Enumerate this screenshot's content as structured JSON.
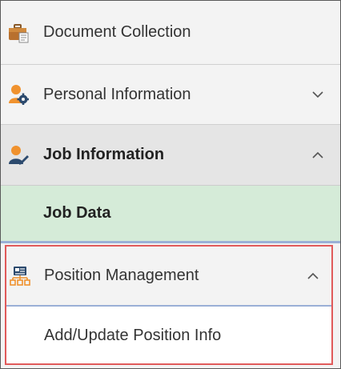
{
  "nav": {
    "items": [
      {
        "label": "Document Collection",
        "icon": "briefcase-icon"
      },
      {
        "label": "Personal Information",
        "icon": "person-gear-icon",
        "chevron": "chevron-down-icon"
      },
      {
        "label": "Job Information",
        "icon": "person-pen-icon",
        "chevron": "chevron-up-icon"
      },
      {
        "label": "Job Data"
      },
      {
        "label": "Position Management",
        "icon": "org-chart-icon",
        "chevron": "chevron-up-icon"
      },
      {
        "label": "Add/Update Position Info"
      }
    ]
  },
  "colors": {
    "selected_background": "#d5ebd8",
    "highlight_border": "#e05a5a",
    "icon_orange": "#f0922e",
    "icon_navy": "#2c4a6e"
  }
}
